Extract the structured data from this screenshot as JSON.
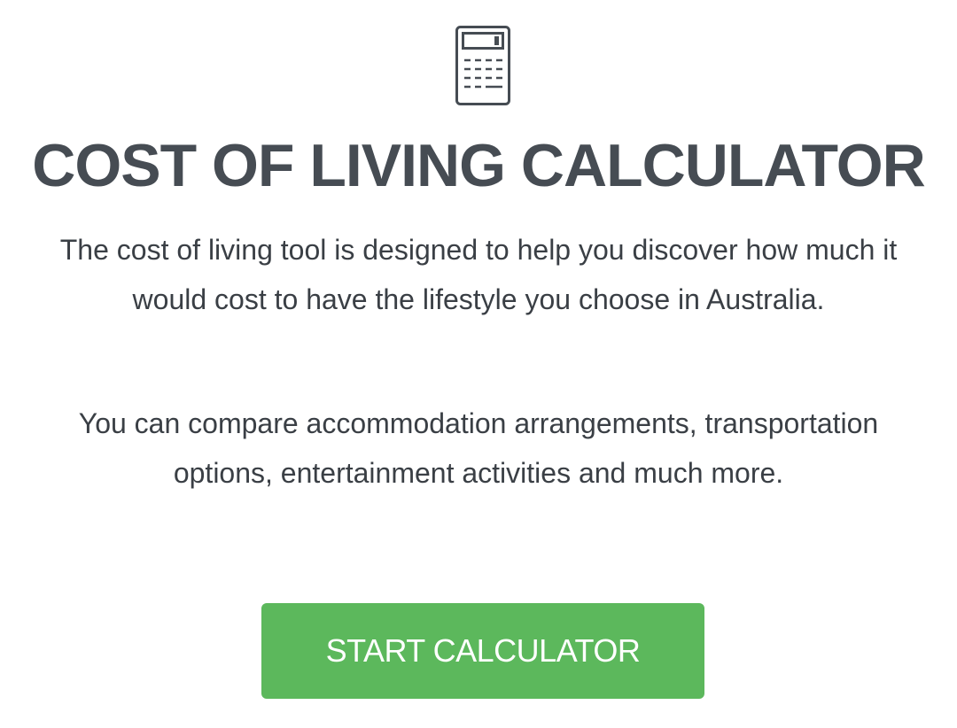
{
  "header": {
    "icon": "calculator-icon",
    "title": "COST OF LIVING CALCULATOR"
  },
  "intro": {
    "paragraph_1": "The cost of living tool is designed to help you discover how much it would cost to have the lifestyle you choose in Australia.",
    "paragraph_2": "You can compare accommodation arrangements, transportation options, entertainment activities and much more."
  },
  "cta": {
    "label": "START CALCULATOR",
    "color": "#5cb85c"
  }
}
